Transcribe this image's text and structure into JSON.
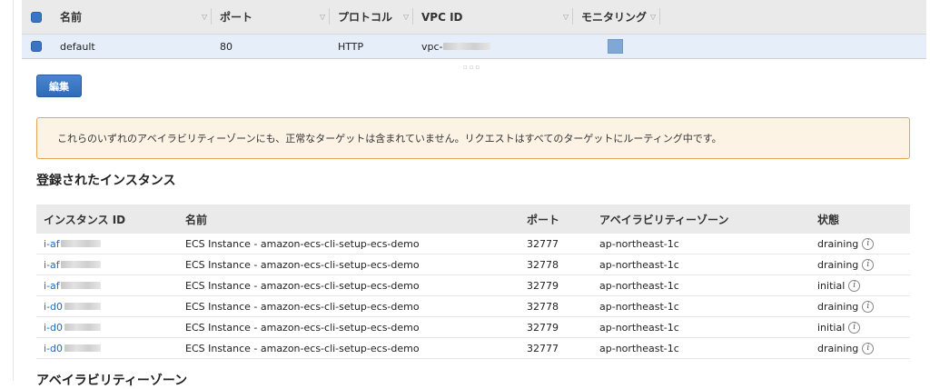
{
  "target_group_table": {
    "columns": [
      "名前",
      "ポート",
      "プロトコル",
      "VPC ID",
      "モニタリング"
    ],
    "row": {
      "name": "default",
      "port": "80",
      "protocol": "HTTP",
      "vpc": "vpc-"
    }
  },
  "edit_button_label": "編集",
  "warning_message": "これらのいずれのアベイラビリティーゾーンにも、正常なターゲットは含まれていません。リクエストはすべてのターゲットにルーティング中です。",
  "registered_instances": {
    "title": "登録されたインスタンス",
    "columns": [
      "インスタンス ID",
      "名前",
      "ポート",
      "アベイラビリティーゾーン",
      "状態"
    ],
    "rows": [
      {
        "id": "i-af",
        "name": "ECS Instance - amazon-ecs-cli-setup-ecs-demo",
        "port": "32777",
        "az": "ap-northeast-1c",
        "status": "draining"
      },
      {
        "id": "i-af",
        "name": "ECS Instance - amazon-ecs-cli-setup-ecs-demo",
        "port": "32778",
        "az": "ap-northeast-1c",
        "status": "draining"
      },
      {
        "id": "i-af",
        "name": "ECS Instance - amazon-ecs-cli-setup-ecs-demo",
        "port": "32779",
        "az": "ap-northeast-1c",
        "status": "initial"
      },
      {
        "id": "i-d0",
        "name": "ECS Instance - amazon-ecs-cli-setup-ecs-demo",
        "port": "32778",
        "az": "ap-northeast-1c",
        "status": "draining"
      },
      {
        "id": "i-d0",
        "name": "ECS Instance - amazon-ecs-cli-setup-ecs-demo",
        "port": "32779",
        "az": "ap-northeast-1c",
        "status": "initial"
      },
      {
        "id": "i-d0",
        "name": "ECS Instance - amazon-ecs-cli-setup-ecs-demo",
        "port": "32777",
        "az": "ap-northeast-1c",
        "status": "draining"
      }
    ]
  },
  "next_section_title": "アベイラビリティーゾーン",
  "info_icon_glyph": "i"
}
